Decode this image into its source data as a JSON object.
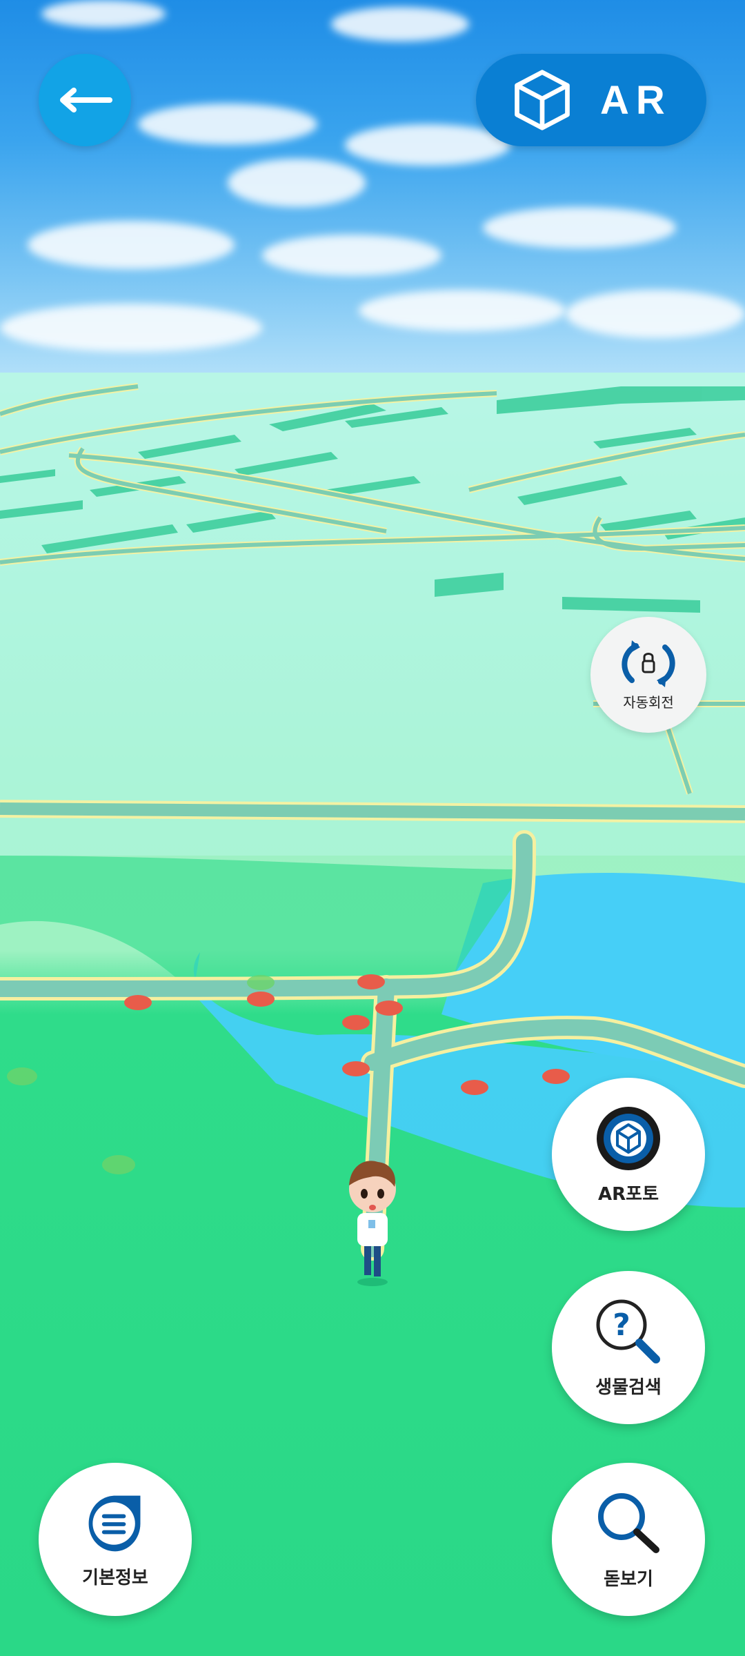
{
  "header": {
    "back_label": "←",
    "ar_label": "AR"
  },
  "controls": {
    "auto_rotate_label": "자동회전",
    "ar_photo_label": "AR포토",
    "species_search_label": "생물검색",
    "magnifier_label": "돋보기",
    "basic_info_label": "기본정보"
  },
  "colors": {
    "accent": "#12a3e6",
    "ar_button": "#0a7fd3",
    "icon_blue": "#0a5ea8",
    "marker_red": "#e85c4a",
    "marker_green": "#6cd36a",
    "path": "#79c7b0",
    "path_edge": "#f5f0a0",
    "water": "#45cff6",
    "grass": "#2fdc8a"
  },
  "icons": {
    "back": "arrow-left-icon",
    "ar": "cube-icon",
    "auto_rotate": "rotate-lock-icon",
    "ar_photo": "cube-camera-icon",
    "species_search": "question-magnifier-icon",
    "magnifier": "magnifier-icon",
    "basic_info": "document-list-icon"
  }
}
